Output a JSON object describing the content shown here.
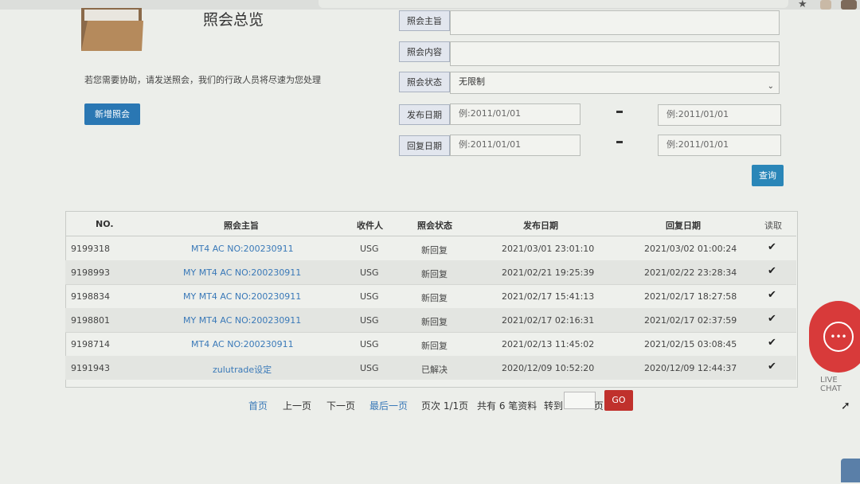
{
  "header": {
    "title": "照会总览",
    "help_text": "若您需要协助，请发送照会，我们的行政人员将尽速为您处理",
    "new_button": "新增照会"
  },
  "filters": {
    "subject_label": "照会主旨",
    "content_label": "照会内容",
    "status_label": "照会状态",
    "status_value": "无限制",
    "publish_label": "发布日期",
    "reply_label": "回复日期",
    "date_placeholder": "例:2011/01/01",
    "search_button": "查询"
  },
  "table": {
    "headers": [
      "NO.",
      "照会主旨",
      "收件人",
      "照会状态",
      "发布日期",
      "回复日期",
      "读取"
    ],
    "rows": [
      {
        "no": "9199318",
        "subject": "MT4 AC NO:200230911",
        "recipient": "USG",
        "status": "新回复",
        "published": "2021/03/01 23:01:10",
        "replied": "2021/03/02 01:00:24",
        "read": "✔"
      },
      {
        "no": "9198993",
        "subject": "MY MT4 AC NO:200230911",
        "recipient": "USG",
        "status": "新回复",
        "published": "2021/02/21 19:25:39",
        "replied": "2021/02/22 23:28:34",
        "read": "✔"
      },
      {
        "no": "9198834",
        "subject": "MY MT4 AC NO:200230911",
        "recipient": "USG",
        "status": "新回复",
        "published": "2021/02/17 15:41:13",
        "replied": "2021/02/17 18:27:58",
        "read": "✔"
      },
      {
        "no": "9198801",
        "subject": "MY MT4 AC NO:200230911",
        "recipient": "USG",
        "status": "新回复",
        "published": "2021/02/17 02:16:31",
        "replied": "2021/02/17 02:37:59",
        "read": "✔"
      },
      {
        "no": "9198714",
        "subject": "MT4 AC NO:200230911",
        "recipient": "USG",
        "status": "新回复",
        "published": "2021/02/13 11:45:02",
        "replied": "2021/02/15 03:08:45",
        "read": "✔"
      },
      {
        "no": "9191943",
        "subject": "zulutrade设定",
        "recipient": "USG",
        "status": "已解决",
        "published": "2020/12/09 10:52:20",
        "replied": "2020/12/09 12:44:37",
        "read": "✔"
      }
    ]
  },
  "pager": {
    "first": "首页",
    "prev": "上一页",
    "next": "下一页",
    "last": "最后一页",
    "page_info": "页次 1/1页",
    "total": "共有 6 笔资料",
    "goto_label": "转到",
    "page_suffix": "页",
    "go_button": "GO"
  },
  "widget": {
    "chat_icon": "chat-dots-icon",
    "live_chat": "LIVE CHAT"
  },
  "colors": {
    "primary_button": "#2a77b3",
    "go_button": "#c0312c",
    "link": "#3a79b8",
    "chat_bubble": "#d83a3a"
  }
}
